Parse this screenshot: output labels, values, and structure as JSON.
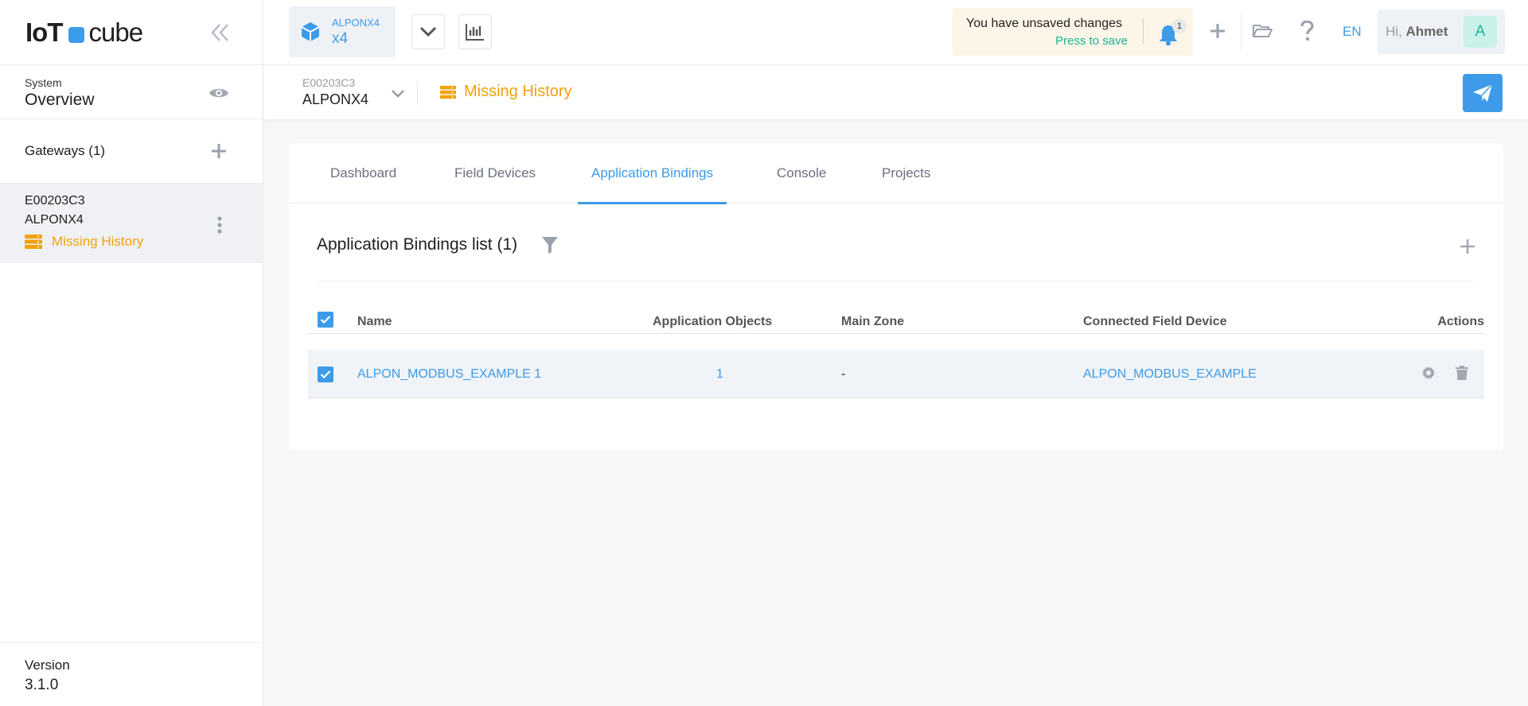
{
  "brand": {
    "logo_bold": "IoT",
    "logo_rest": "cube"
  },
  "sidebar": {
    "system_label": "System",
    "overview_label": "Overview",
    "gateways_label": "Gateways (1)",
    "gateway": {
      "id": "E00203C3",
      "name": "ALPONX4",
      "status": "Missing History"
    },
    "version_label": "Version",
    "version_value": "3.1.0"
  },
  "topbar": {
    "device_type": "ALPONX4",
    "device_short": "x4",
    "unsaved_text": "You have unsaved changes",
    "save_link": "Press to save",
    "notification_count": "1",
    "language": "EN",
    "greeting": "Hi,",
    "user_name": "Ahmet",
    "avatar_letter": "A"
  },
  "subheader": {
    "gateway_id": "E00203C3",
    "gateway_name": "ALPONX4",
    "status": "Missing History"
  },
  "tabs": [
    "Dashboard",
    "Field Devices",
    "Application Bindings",
    "Console",
    "Projects"
  ],
  "active_tab": "Application Bindings",
  "list": {
    "title": "Application Bindings list (1)",
    "columns": {
      "name": "Name",
      "app_objects": "Application Objects",
      "main_zone": "Main Zone",
      "connected": "Connected Field Device",
      "actions": "Actions"
    },
    "rows": [
      {
        "name": "ALPON_MODBUS_EXAMPLE 1",
        "app_objects": "1",
        "main_zone": "-",
        "connected": "ALPON_MODBUS_EXAMPLE"
      }
    ]
  },
  "icons": {
    "collapse": "double-chevron-left-icon",
    "eye": "eye-icon",
    "plus": "plus-icon",
    "kebab": "vertical-dots-icon",
    "history": "server-stack-icon",
    "device": "cube-icon",
    "bell": "bell-icon",
    "folder": "folder-open-icon",
    "help": "question-icon",
    "send": "paper-plane-icon",
    "filter": "filter-icon",
    "settings": "gear-icon",
    "trash": "trash-icon",
    "chart": "bar-chart-icon"
  },
  "colors": {
    "accent": "#3d9be9",
    "warning": "#f2a20b",
    "success": "#1ab394"
  }
}
